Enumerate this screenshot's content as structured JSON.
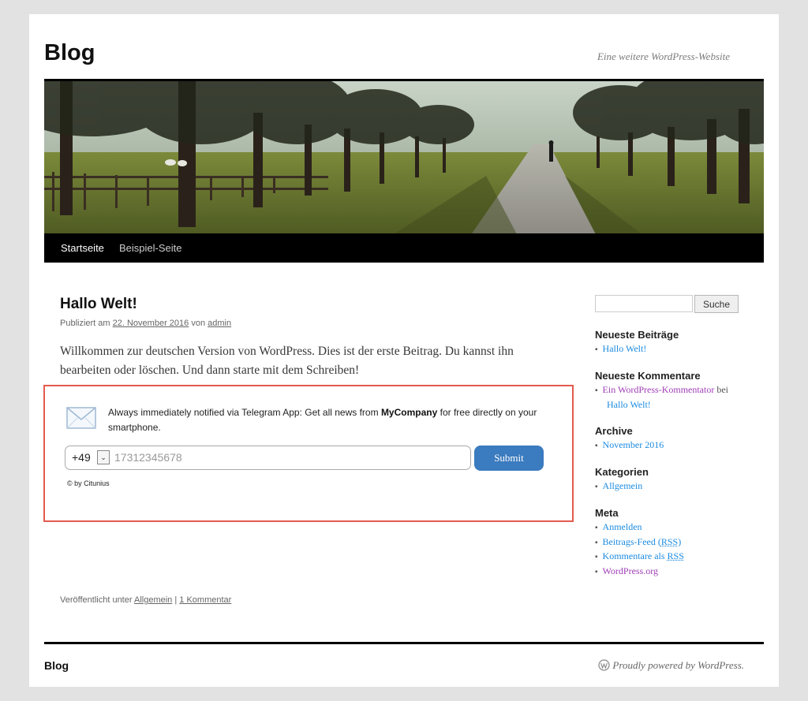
{
  "site": {
    "title": "Blog",
    "description": "Eine weitere WordPress-Website"
  },
  "nav": {
    "items": [
      {
        "label": "Startseite"
      },
      {
        "label": "Beispiel-Seite"
      }
    ]
  },
  "post": {
    "title": "Hallo Welt!",
    "meta_prefix": "Publiziert am ",
    "date": "22. November 2016",
    "meta_by": " von ",
    "author": "admin",
    "body": "Willkommen zur deutschen Version von WordPress. Dies ist der erste Beitrag. Du kannst ihn bearbeiten oder löschen. Und dann starte mit dem Schreiben!",
    "footer_prefix": "Veröffentlicht unter ",
    "category": "Allgemein",
    "footer_sep": " | ",
    "comments": "1 Kommentar"
  },
  "widget": {
    "text_before": "Always immediately notified via Telegram App: Get all news from ",
    "company": "MyCompany",
    "text_after": " for free directly on your smartphone.",
    "country_code": "+49",
    "phone_placeholder": "17312345678",
    "submit_label": "Submit",
    "credit": "© by Citunius",
    "border_color": "#e45b4e",
    "button_color": "#3b7bbf"
  },
  "sidebar": {
    "search_button": "Suche",
    "recent_posts": {
      "title": "Neueste Beiträge",
      "items": [
        "Hallo Welt!"
      ]
    },
    "recent_comments": {
      "title": "Neueste Kommentare",
      "author": "Ein WordPress-Kommentator",
      "connector": " bei",
      "post": "Hallo Welt!"
    },
    "archive": {
      "title": "Archive",
      "items": [
        "November 2016"
      ]
    },
    "categories": {
      "title": "Kategorien",
      "items": [
        "Allgemein"
      ]
    },
    "meta": {
      "title": "Meta",
      "login": "Anmelden",
      "entries_feed_prefix": "Beitrags-Feed (",
      "rss": "RSS",
      "entries_feed_suffix": ")",
      "comments_feed_prefix": "Kommentare als ",
      "comments_rss": "RSS",
      "wordpress_org": "WordPress.org"
    }
  },
  "footer": {
    "blog": "Blog",
    "powered": "Proudly powered by WordPress."
  }
}
